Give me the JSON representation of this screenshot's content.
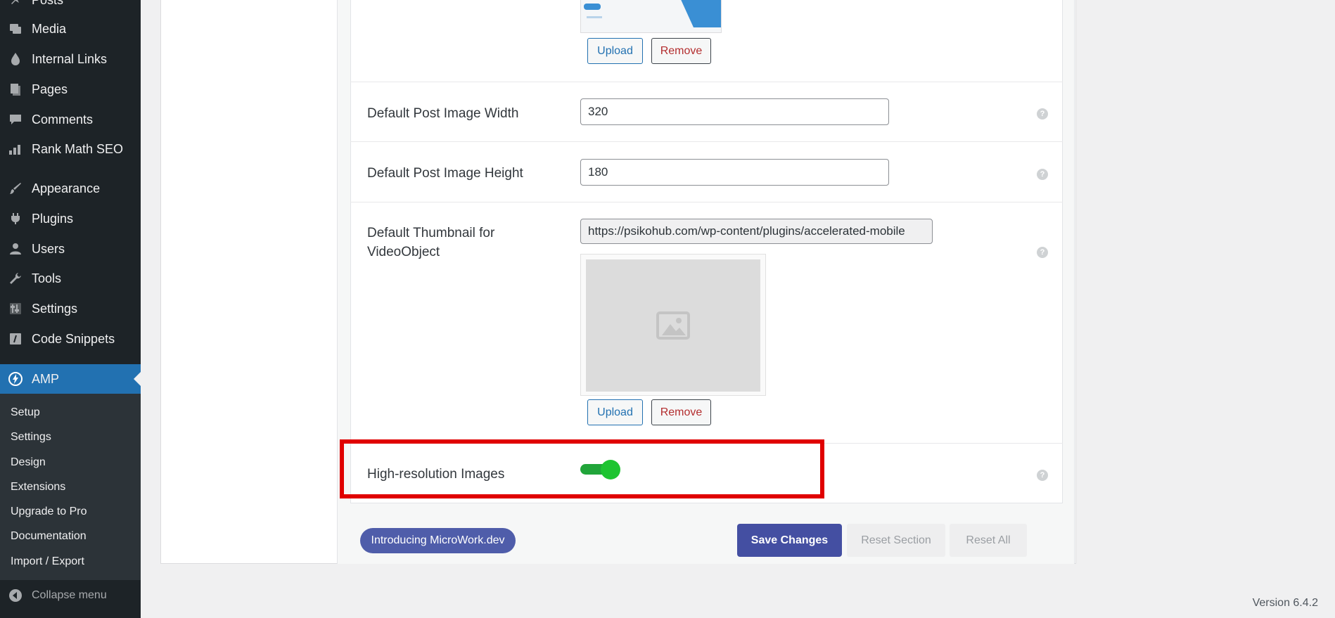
{
  "sidebar": {
    "items": [
      {
        "label": "Posts",
        "icon": "pin-icon"
      },
      {
        "label": "Media",
        "icon": "media-icon"
      },
      {
        "label": "Internal Links",
        "icon": "drop-icon"
      },
      {
        "label": "Pages",
        "icon": "pages-icon"
      },
      {
        "label": "Comments",
        "icon": "comment-icon"
      },
      {
        "label": "Rank Math SEO",
        "icon": "chart-icon"
      },
      {
        "label": "Appearance",
        "icon": "brush-icon"
      },
      {
        "label": "Plugins",
        "icon": "plug-icon"
      },
      {
        "label": "Users",
        "icon": "user-icon"
      },
      {
        "label": "Tools",
        "icon": "wrench-icon"
      },
      {
        "label": "Settings",
        "icon": "sliders-icon"
      },
      {
        "label": "Code Snippets",
        "icon": "code-icon"
      },
      {
        "label": "AMP",
        "icon": "bolt-icon"
      }
    ],
    "submenu": [
      "Setup",
      "Settings",
      "Design",
      "Extensions",
      "Upgrade to Pro",
      "Documentation",
      "Import / Export"
    ],
    "collapse_label": "Collapse menu"
  },
  "fields": {
    "top_upload": "Upload",
    "top_remove": "Remove",
    "width_label": "Default Post Image Width",
    "width_value": "320",
    "height_label": "Default Post Image Height",
    "height_value": "180",
    "thumb_label": "Default Thumbnail for VideoObject",
    "thumb_url": "https://psikohub.com/wp-content/plugins/accelerated-mobile",
    "thumb_upload": "Upload",
    "thumb_remove": "Remove",
    "hires_label": "High-resolution Images",
    "hires_enabled": true,
    "help_glyph": "?"
  },
  "footer": {
    "micro_label": "Introducing MicroWork.dev",
    "save_label": "Save Changes",
    "reset_section_label": "Reset Section",
    "reset_all_label": "Reset All"
  },
  "version": "Version 6.4.2",
  "colors": {
    "sidebar_bg": "#1d2327",
    "active_bg": "#2271b1",
    "toggle_on": "#1ec431",
    "highlight": "#e00000",
    "save_btn": "#444fa2"
  }
}
